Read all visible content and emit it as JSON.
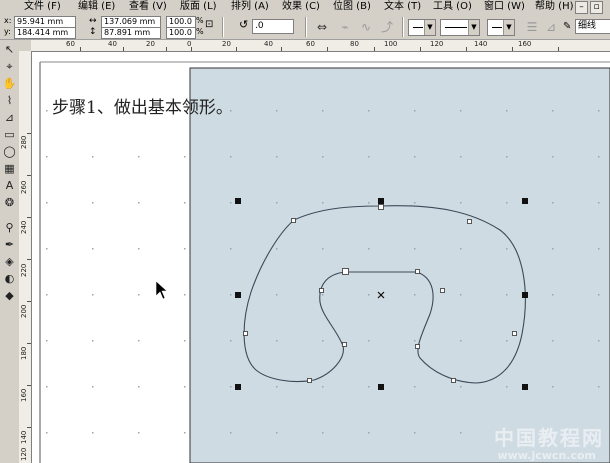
{
  "menubar": {
    "items": [
      "文件 (F)",
      "编辑 (E)",
      "查看 (V)",
      "版面 (L)",
      "排列 (A)",
      "效果 (C)",
      "位图 (B)",
      "文本 (T)",
      "工具 (O)",
      "窗口 (W)",
      "帮助 (H)"
    ]
  },
  "propbar": {
    "x_label": "x:",
    "x_value": "95.941 mm",
    "y_label": "y:",
    "y_value": "184.414 mm",
    "width_value": "137.069 mm",
    "height_value": "87.891 mm",
    "scale_x": "100.0",
    "scale_y": "100.0",
    "percent_x": "%",
    "percent_y": "%",
    "rotation_value": ".0",
    "outline_width": "细线"
  },
  "rulers": {
    "horizontal": [
      "60",
      "40",
      "20",
      "0",
      "20",
      "40",
      "60",
      "80",
      "100",
      "120",
      "140",
      "160"
    ],
    "vertical": [
      "280",
      "260",
      "240",
      "220",
      "200",
      "180",
      "160",
      "140",
      "120"
    ]
  },
  "canvas": {
    "step_text": "步骤1、做出基本领形。",
    "page_color": "#cfdbe3",
    "watermark": "中国教程网",
    "watermark_url": "www.jcwcn.com"
  }
}
